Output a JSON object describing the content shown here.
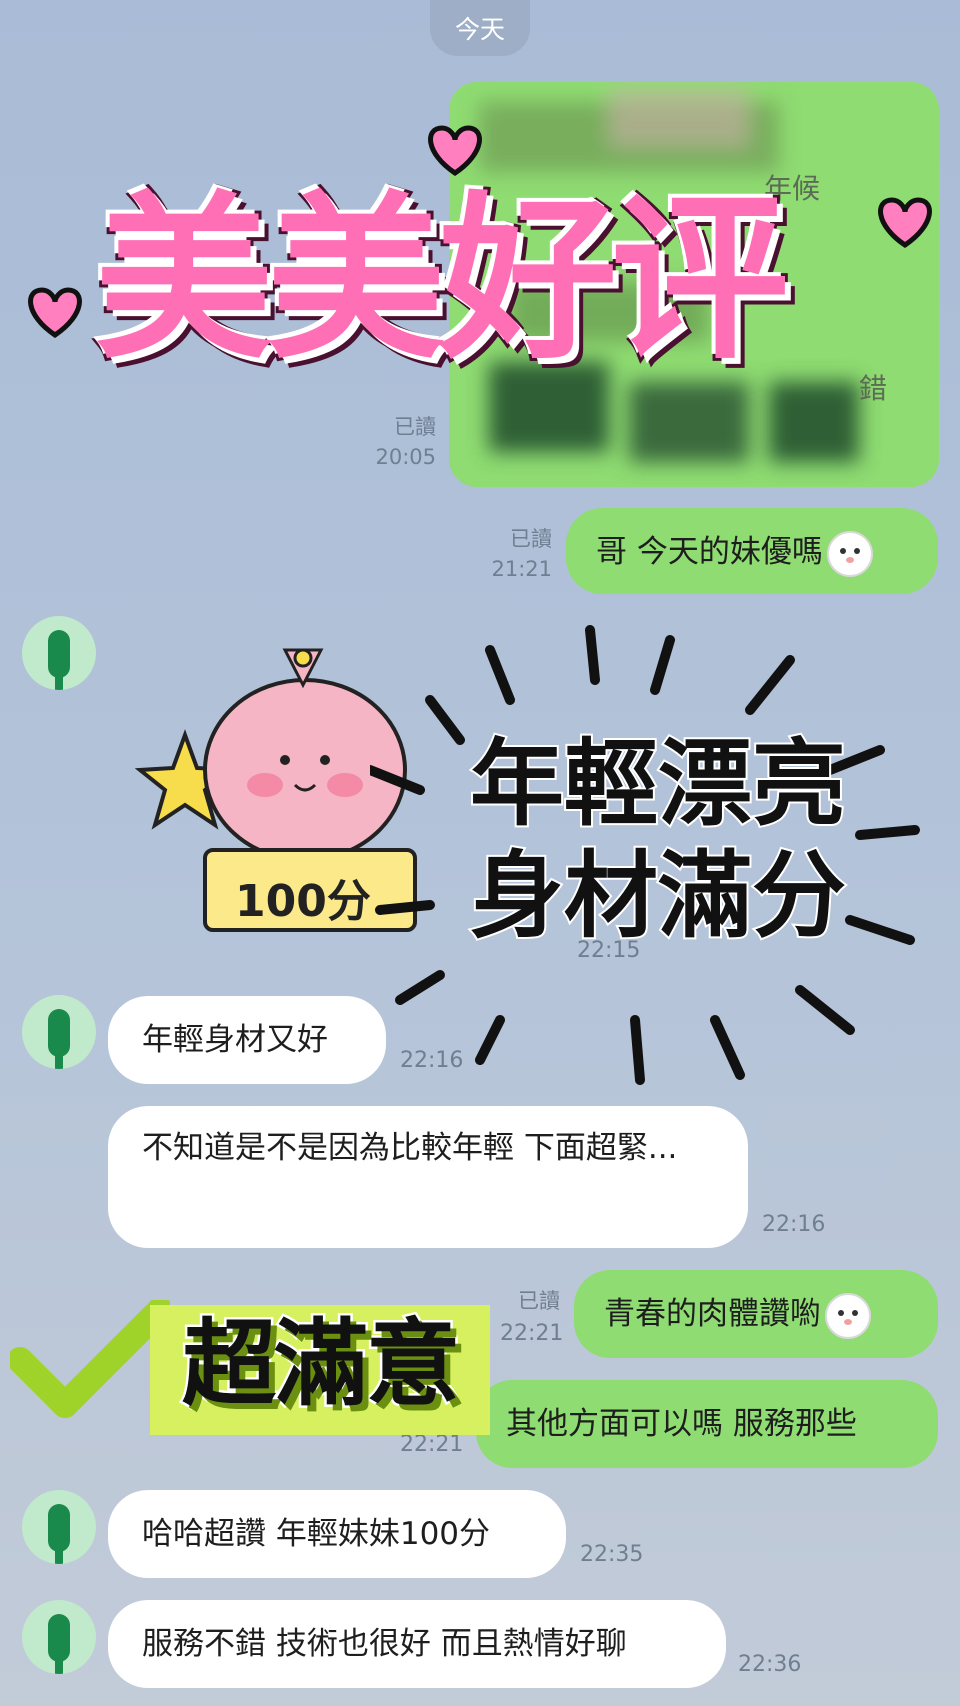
{
  "date_chip": "今天",
  "messages": [
    {
      "read": "已讀",
      "time": "20:05"
    },
    {
      "read": "已讀",
      "time": "21:21",
      "text": "哥 今天的妹優嗎"
    },
    {
      "time": "22:15"
    },
    {
      "time": "22:16",
      "text": "年輕身材又好"
    },
    {
      "time": "22:16",
      "text": "不知道是不是因為比較年輕 下面超緊..."
    },
    {
      "read": "已讀",
      "time": "22:21",
      "text": "青春的肉體讚喲"
    },
    {
      "time": "22:21",
      "text": "其他方面可以嗎 服務那些"
    },
    {
      "time": "22:35",
      "text": "哈哈超讚 年輕妹妹100分"
    },
    {
      "time": "22:36",
      "text": "服務不錯 技術也很好 而且熱情好聊"
    }
  ],
  "blurred_image": {
    "visible_text_1": "年候",
    "visible_text_2": "錯"
  },
  "overlay": {
    "headline": "美美好评",
    "sticker_card": "100分",
    "callout_line1": "年輕漂亮",
    "callout_line2": "身材滿分",
    "badge": "超滿意"
  },
  "colors": {
    "bg": "#b3c3d9",
    "outgoing": "#8fdc72",
    "incoming": "#ffffff",
    "headline_pink": "#ff5fa8"
  },
  "icons": [
    "bunny-emoji-icon",
    "keroppi-avatar-icon",
    "checkmark-icon",
    "heart-icon"
  ]
}
